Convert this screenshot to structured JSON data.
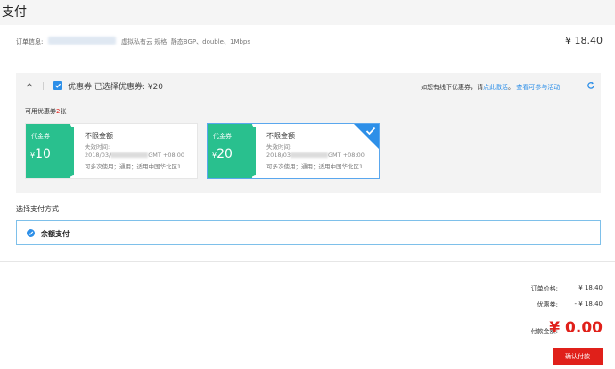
{
  "page": {
    "title": "支付"
  },
  "order": {
    "label": "订单信息:",
    "spec": "虚拟私有云 规格: 静态BGP、double、1Mbps",
    "price": "¥ 18.40"
  },
  "coupons": {
    "header": "优惠券 已选择优惠券: ¥20",
    "offline_tip": "如您有线下优惠券，请",
    "activate_link": "点此激活",
    "sep": "。",
    "view_link": "查看可参与活动",
    "available_prefix": "可用优惠券",
    "available_count": "2",
    "available_suffix": "张",
    "cards": [
      {
        "type": "代金券",
        "currency": "¥",
        "amount": "10",
        "name": "不限金额",
        "valid_label": "失效时间:",
        "date_prefix": "2018/03/",
        "date_suffix": "GMT +08:00",
        "desc": "可多次使用；通用；适用中国华北区1...",
        "selected": false
      },
      {
        "type": "代金券",
        "currency": "¥",
        "amount": "20",
        "name": "不限金额",
        "valid_label": "失效时间:",
        "date_prefix": "2018/03",
        "date_suffix": "GMT +08:00",
        "desc": "可多次使用；通用；适用中国华北区1...",
        "selected": true
      }
    ]
  },
  "payment": {
    "section_title": "选择支付方式",
    "method": "余额支付"
  },
  "summary": {
    "order_price_label": "订单价格:",
    "order_price": "¥ 18.40",
    "coupon_label": "优惠券:",
    "coupon_value": "- ¥ 18.40",
    "pay_label": "付款金额:",
    "pay_value": "¥ 0.00",
    "confirm": "确认付款"
  },
  "colors": {
    "accent": "#2d8fe8",
    "coupon_green": "#29c08e",
    "price_red": "#e0201a"
  }
}
